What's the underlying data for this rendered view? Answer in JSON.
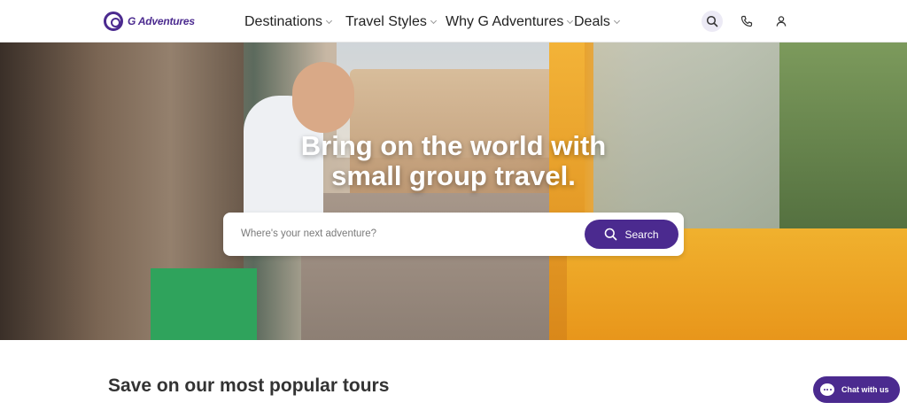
{
  "header": {
    "logo_text": "G Adventures",
    "nav": [
      {
        "label": "Destinations"
      },
      {
        "label": "Travel Styles"
      },
      {
        "label": "Why G Adventures"
      },
      {
        "label": "Deals"
      }
    ],
    "icons": [
      "search-icon",
      "phone-icon",
      "user-icon"
    ]
  },
  "hero": {
    "headline_line1": "Bring on the world with",
    "headline_line2": "small group travel.",
    "search": {
      "placeholder": "Where's your next adventure?",
      "value": "",
      "button_label": "Search"
    }
  },
  "section": {
    "title": "Save on our most popular tours"
  },
  "chat": {
    "label": "Chat with us"
  },
  "colors": {
    "brand": "#4b2a8f",
    "search_icon_bg": "#eceaf5"
  }
}
